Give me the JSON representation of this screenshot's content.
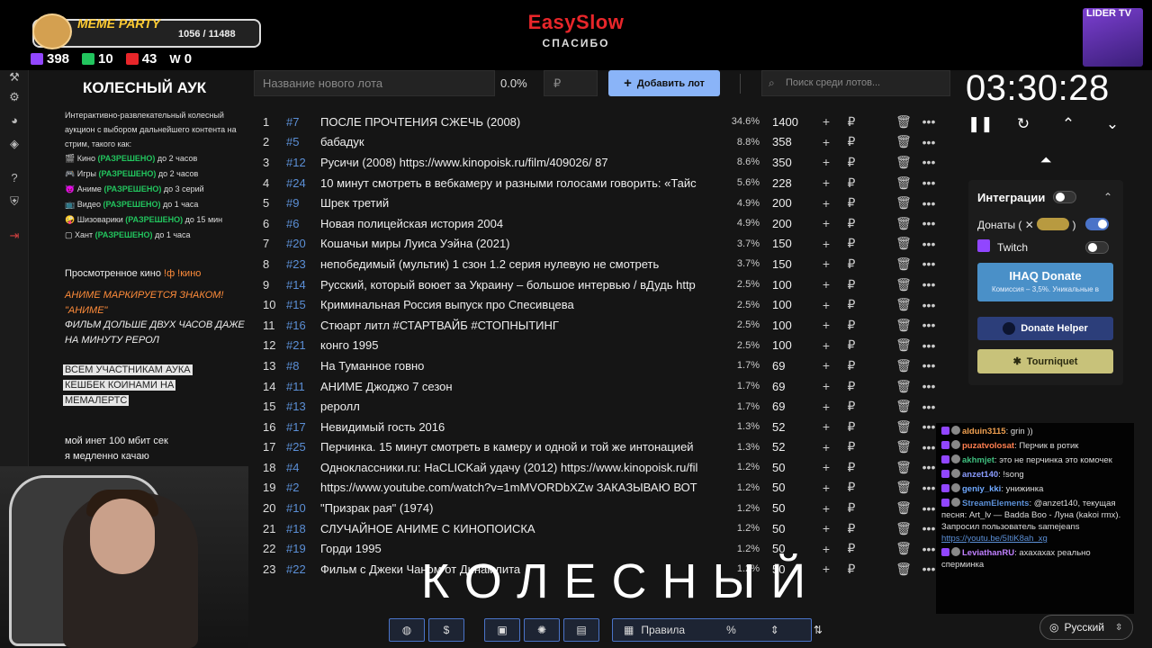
{
  "overlay": {
    "meme_title": "MEME PARTY",
    "meme_progress": "1056 / 11488",
    "meme_fill": 0.092,
    "stats": [
      {
        "icon": "twitch-icon",
        "value": "398"
      },
      {
        "icon": "kick-icon",
        "value": "10"
      },
      {
        "icon": "vk-live-icon",
        "value": "43"
      },
      {
        "icon": "w-icon",
        "value": "0"
      }
    ],
    "brand": "EasySlow",
    "brand_sub": "СПАСИБО",
    "channel_logo": "LIDER TV"
  },
  "info_panel": {
    "title": "КОЛЕСНЫЙ АУК",
    "description": "Интерактивно-развлекательный колесный аукцион с выбором дальнейшего контента на стрим, такого как:",
    "rules": [
      {
        "icon": "🎬",
        "name": "Кино",
        "status": "(РАЗРЕШЕНО)",
        "limit": "до 2 часов"
      },
      {
        "icon": "🎮",
        "name": "Игры",
        "status": "(РАЗРЕШЕНО)",
        "limit": "до 2 часов"
      },
      {
        "icon": "😈",
        "name": "Аниме",
        "status": "(РАЗРЕШЕНО)",
        "limit": "до 3 серий"
      },
      {
        "icon": "📺",
        "name": "Видео",
        "status": "(РАЗРЕШЕНО)",
        "limit": "до 1 часа"
      },
      {
        "icon": "🤪",
        "name": "Шизоварики",
        "status": "(РАЗРЕШЕНО)",
        "limit": "до 15 мин"
      },
      {
        "icon": "▢",
        "name": "Хант",
        "status": "(РАЗРЕШЕНО)",
        "limit": "до 1 часа"
      }
    ],
    "watched_label": "Просмотренное кино",
    "watched_cmd": "!ф !кино",
    "anime_note": "АНИМЕ МАРКИРУЕТСЯ ЗНАКОМ! \"АНИМЕ\"",
    "film_note": "ФИЛЬМ ДОЛЬШЕ ДВУХ ЧАСОВ ДАЖЕ НА МИНУТУ РЕРОЛ",
    "cashback": [
      "ВСЕМ УЧАСТНИКАМ АУКА",
      "КЕШБЕК КОИНАМИ НА",
      "МЕМАЛЕРТС"
    ],
    "inet": [
      "мой инет 100 мбит сек",
      "я медленно качаю"
    ]
  },
  "toolbar": {
    "lot_placeholder": "Название нового лота",
    "percent": "0.0%",
    "currency": "₽",
    "add_label": "Добавить лот",
    "search_placeholder": "Поиск среди лотов..."
  },
  "lots": [
    {
      "idx": "1",
      "id": "#7",
      "name": "ПОСЛЕ ПРОЧТЕНИЯ СЖЕЧЬ (2008)",
      "pct": "34.6%",
      "amount": "1400"
    },
    {
      "idx": "2",
      "id": "#5",
      "name": "бабадук",
      "pct": "8.8%",
      "amount": "358"
    },
    {
      "idx": "3",
      "id": "#12",
      "name": "Русичи (2008) https://www.kinopoisk.ru/film/409026/ 87",
      "pct": "8.6%",
      "amount": "350"
    },
    {
      "idx": "4",
      "id": "#24",
      "name": " 10 минут смотреть в вебкамеру и разными голосами говорить: «Тайс",
      "pct": "5.6%",
      "amount": "228"
    },
    {
      "idx": "5",
      "id": "#9",
      "name": "Шрек третий",
      "pct": "4.9%",
      "amount": "200"
    },
    {
      "idx": "6",
      "id": "#6",
      "name": "Новая полицейская история 2004",
      "pct": "4.9%",
      "amount": "200"
    },
    {
      "idx": "7",
      "id": "#20",
      "name": " Кошачьи миры Луиса Уэйна (2021)",
      "pct": "3.7%",
      "amount": "150"
    },
    {
      "idx": "8",
      "id": "#23",
      "name": " непобедимый (мультик) 1 сзон 1.2 серия нулевую не смотреть",
      "pct": "3.7%",
      "amount": "150"
    },
    {
      "idx": "9",
      "id": "#14",
      "name": " Русский, который воюет за Украину – большое интервью / вДудь  http",
      "pct": "2.5%",
      "amount": "100"
    },
    {
      "idx": "10",
      "id": "#15",
      "name": " Криминальная Россия выпуск про Спесивцева",
      "pct": "2.5%",
      "amount": "100"
    },
    {
      "idx": "11",
      "id": "#16",
      "name": " Стюарт литл #СТАРТВАЙБ #СТОПНЫТИНГ",
      "pct": "2.5%",
      "amount": "100"
    },
    {
      "idx": "12",
      "id": "#21",
      "name": " конго 1995",
      "pct": "2.5%",
      "amount": "100"
    },
    {
      "idx": "13",
      "id": "#8",
      "name": "На Туманное говно",
      "pct": "1.7%",
      "amount": "69"
    },
    {
      "idx": "14",
      "id": "#11",
      "name": "АНИМЕ Джоджо 7 сезон",
      "pct": "1.7%",
      "amount": "69"
    },
    {
      "idx": "15",
      "id": "#13",
      "name": "реролл",
      "pct": "1.7%",
      "amount": "69"
    },
    {
      "idx": "16",
      "id": "#17",
      "name": " Невидимый гость 2016",
      "pct": "1.3%",
      "amount": "52"
    },
    {
      "idx": "17",
      "id": "#25",
      "name": " Перчинка. 15 минут смотреть в камеру и одной и той же интонацией",
      "pct": "1.3%",
      "amount": "52"
    },
    {
      "idx": "18",
      "id": "#4",
      "name": "Одноклассники.ru: НаCLICKай удачу (2012) https://www.kinopoisk.ru/fil",
      "pct": "1.2%",
      "amount": "50"
    },
    {
      "idx": "19",
      "id": "#2",
      "name": "https://www.youtube.com/watch?v=1mMVORDbXZw  ЗАКАЗЫВАЮ ВОТ",
      "pct": "1.2%",
      "amount": "50"
    },
    {
      "idx": "20",
      "id": "#10",
      "name": " \"Призрак рая\" (1974)",
      "pct": "1.2%",
      "amount": "50"
    },
    {
      "idx": "21",
      "id": "#18",
      "name": " СЛУЧАЙНОЕ АНИМЕ С КИНОПОИСКА",
      "pct": "1.2%",
      "amount": "50"
    },
    {
      "idx": "22",
      "id": "#19",
      "name": " Горди 1995",
      "pct": "1.2%",
      "amount": "50"
    },
    {
      "idx": "23",
      "id": "#22",
      "name": " Фильм с Джеки Чаном от Динамлита",
      "pct": "1.2%",
      "amount": "50"
    }
  ],
  "timer": {
    "value": "03:30:28"
  },
  "integrations": {
    "title": "Интеграции",
    "donations_label": "Донаты (",
    "donations_suffix": ")",
    "twitch_label": "Twitch",
    "ihaq_title": "IHAQ Donate",
    "ihaq_sub": "Комиссия – 3,5%. Уникальные в",
    "donate_helper": "Donate Helper",
    "tourniquet": "Tourniquet"
  },
  "chat": [
    {
      "user": "alduin3115",
      "color": "#f0a050",
      "text": "grin ))"
    },
    {
      "user": "puzatvolosat",
      "color": "#ff7f50",
      "text": "Перчик в ротик"
    },
    {
      "user": "akhmjet",
      "color": "#3fbf7f",
      "text": "это не перчинка это комочек"
    },
    {
      "user": "anzet140",
      "color": "#8a9cff",
      "text": "!song"
    },
    {
      "user": "geniy_kki",
      "color": "#6fa8ff",
      "text": "унижинка"
    },
    {
      "user": "StreamElements",
      "color": "#5b8fd6",
      "text": "@anzet140, текущая песня: Art_lv — Badda Boo - Луна (kakoi rmx). Запросил пользователь samejeans",
      "link": "https://youtu.be/5ItiK8ah_xg"
    },
    {
      "user": "LeviathanRU",
      "color": "#c080ff",
      "text": "ахахахах реально сперминка"
    }
  ],
  "overlay_word": "КОЛЕСНЫЙ",
  "bottom_bar": {
    "rules_label": "Правила"
  },
  "language": {
    "selected": "Русский"
  }
}
